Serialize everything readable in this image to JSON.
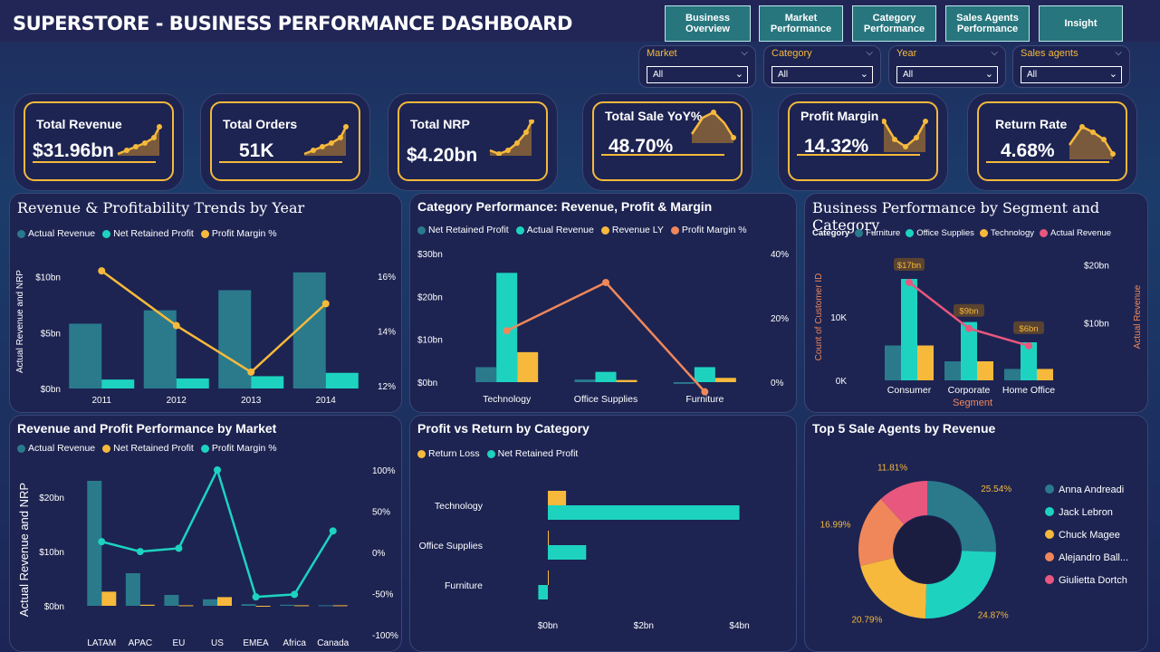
{
  "header": {
    "title": "SUPERSTORE - BUSINESS PERFORMANCE DASHBOARD",
    "nav": [
      "Business Overview",
      "Market Performance",
      "Category Performance",
      "Sales Agents Performance",
      "Insight"
    ]
  },
  "filters": [
    {
      "label": "Market",
      "value": "All"
    },
    {
      "label": "Category",
      "value": "All"
    },
    {
      "label": "Year",
      "value": "All"
    },
    {
      "label": "Sales agents",
      "value": "All"
    }
  ],
  "kpis": [
    {
      "label": "Total Revenue",
      "value": "$31.96bn"
    },
    {
      "label": "Total Orders",
      "value": "51K"
    },
    {
      "label": "Total NRP",
      "value": "$4.20bn"
    },
    {
      "label": "Total Sale YoY%",
      "value": "48.70%"
    },
    {
      "label": "Profit Margin",
      "value": "14.32%"
    },
    {
      "label": "Return Rate",
      "value": "4.68%"
    }
  ],
  "colors": {
    "teal_dark": "#2a7a8c",
    "teal": "#1dd3c0",
    "gold": "#f6b93b",
    "salmon": "#f0875a",
    "pink": "#e8577e",
    "panel": "#1d2452"
  },
  "chart_data": [
    {
      "id": "trends",
      "type": "bar",
      "title": "Revenue & Profitability Trends by Year",
      "ylabel": "Actual Revenue and NRP",
      "categories": [
        "2011",
        "2012",
        "2013",
        "2014"
      ],
      "series": [
        {
          "name": "Actual Revenue",
          "values": [
            5.8,
            7.0,
            8.8,
            10.4
          ]
        },
        {
          "name": "Net Retained Profit",
          "values": [
            0.8,
            0.9,
            1.1,
            1.4
          ]
        },
        {
          "name": "Profit Margin %",
          "values": [
            16.2,
            14.2,
            12.5,
            15.0
          ],
          "axis": "right"
        }
      ],
      "yticks": [
        "$0bn",
        "$5bn",
        "$10bn"
      ],
      "ylim": [
        0,
        12
      ],
      "y2ticks": [
        "12%",
        "14%",
        "16%"
      ],
      "y2lim": [
        11.9,
        16.8
      ]
    },
    {
      "id": "category",
      "type": "bar",
      "title": "Category Performance: Revenue, Profit & Margin",
      "categories": [
        "Technology",
        "Office Supplies",
        "Furniture"
      ],
      "series": [
        {
          "name": "Net Retained Profit",
          "values": [
            3.5,
            0.6,
            -0.4
          ]
        },
        {
          "name": "Actual Revenue",
          "values": [
            25.5,
            2.4,
            3.5
          ]
        },
        {
          "name": "Revenue LY",
          "values": [
            7.0,
            0.5,
            1.0
          ]
        },
        {
          "name": "Profit Margin %",
          "values": [
            16,
            31,
            -3
          ],
          "axis": "right"
        }
      ],
      "yticks": [
        "$0bn",
        "$10bn",
        "$20bn",
        "$30bn"
      ],
      "ylim": [
        0,
        30
      ],
      "y2ticks": [
        "0%",
        "20%",
        "40%"
      ],
      "y2lim": [
        0,
        40
      ]
    },
    {
      "id": "segment",
      "type": "bar",
      "title": "Business Performance by Segment and Category",
      "xlabel": "Segment",
      "ylabel": "Count of Customer ID",
      "y2label": "Actual Revenue",
      "legend_title": "Category",
      "categories": [
        "Consumer",
        "Corporate",
        "Home Office"
      ],
      "series": [
        {
          "name": "Furniture",
          "values": [
            5.5,
            3.0,
            1.8
          ]
        },
        {
          "name": "Office Supplies",
          "values": [
            16.0,
            9.2,
            6.0
          ]
        },
        {
          "name": "Technology",
          "values": [
            5.5,
            3.0,
            1.8
          ]
        },
        {
          "name": "Actual Revenue",
          "values": [
            17,
            9,
            6
          ],
          "axis": "right"
        }
      ],
      "data_labels": [
        "$17bn",
        "$9bn",
        "$6bn"
      ],
      "yticks": [
        "0K",
        "10K"
      ],
      "ylim": [
        0,
        20
      ],
      "y2ticks": [
        "$10bn",
        "$20bn"
      ],
      "y2lim": [
        0,
        22
      ]
    },
    {
      "id": "market",
      "type": "bar",
      "title": "Revenue and Profit Performance by Market",
      "ylabel": "Actual Revenue and NRP",
      "categories": [
        "LATAM",
        "APAC",
        "EU",
        "US",
        "EMEA",
        "Africa",
        "Canada"
      ],
      "series": [
        {
          "name": "Actual Revenue",
          "values": [
            23,
            6,
            2,
            1.2,
            0.3,
            0.2,
            0.1
          ]
        },
        {
          "name": "Net Retained Profit",
          "values": [
            2.6,
            0.2,
            0.1,
            1.6,
            -0.1,
            0.1,
            0.1
          ]
        },
        {
          "name": "Profit Margin %",
          "values": [
            13,
            1,
            5,
            100,
            -54,
            -51,
            26
          ],
          "axis": "right"
        }
      ],
      "yticks": [
        "$0bn",
        "$10bn",
        "$20bn"
      ],
      "ylim": [
        0,
        25
      ],
      "y2ticks": [
        "-100%",
        "-50%",
        "0%",
        "50%",
        "100%"
      ],
      "y2lim": [
        -100,
        100
      ]
    },
    {
      "id": "profit_return",
      "type": "bar",
      "title": "Profit vs Return by Category",
      "categories": [
        "Technology",
        "Office Supplies",
        "Furniture"
      ],
      "series": [
        {
          "name": "Return Loss",
          "values": [
            0.38,
            0.02,
            0.01
          ]
        },
        {
          "name": "Net Retained Profit",
          "values": [
            4.0,
            0.8,
            -0.2
          ]
        }
      ],
      "xticks": [
        "$0bn",
        "$2bn",
        "$4bn"
      ],
      "xlim": [
        0,
        4.5
      ]
    },
    {
      "id": "agents",
      "type": "pie",
      "title": "Top 5 Sale Agents by Revenue",
      "labels": [
        "Anna Andreadi",
        "Jack Lebron",
        "Chuck Magee",
        "Alejandro Ball...",
        "Giulietta Dortch"
      ],
      "values": [
        25.54,
        24.87,
        20.79,
        16.99,
        11.81
      ],
      "value_labels": [
        "25.54%",
        "24.87%",
        "20.79%",
        "16.99%",
        "11.81%"
      ]
    }
  ]
}
